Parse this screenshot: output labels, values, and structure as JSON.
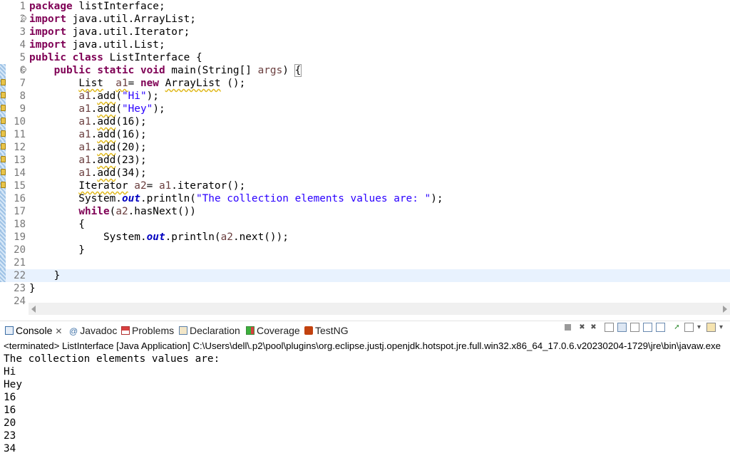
{
  "editor": {
    "lines": [
      {
        "n": "1",
        "html": "<span class='kw'>package</span> listInterface;"
      },
      {
        "n": "2",
        "html": "<span class='kw'>import</span> java.util.ArrayList;",
        "fold": "⊖"
      },
      {
        "n": "3",
        "html": "<span class='kw'>import</span> java.util.Iterator;"
      },
      {
        "n": "4",
        "html": "<span class='kw'>import</span> java.util.List;"
      },
      {
        "n": "5",
        "html": "<span class='kw'>public</span> <span class='kw'>class</span> ListInterface {"
      },
      {
        "n": "6",
        "html": "    <span class='kw'>public</span> <span class='kw'>static</span> <span class='kw'>void</span> main(String[] <span class='var'>args</span>) <span class='brace-box'>{</span>",
        "fold": "⊖",
        "mark": true
      },
      {
        "n": "7",
        "html": "        <span class='warnline'>List</span>  <span class='var warnline'>a1</span>= <span class='kw'>new</span> <span class='warnline'>ArrayList</span> ();",
        "mark": true,
        "warn": true
      },
      {
        "n": "8",
        "html": "        <span class='var'>a1</span>.<span class='warnline'>add</span>(<span class='str'>\"Hi\"</span>);",
        "mark": true,
        "warn": true
      },
      {
        "n": "9",
        "html": "        <span class='var'>a1</span>.<span class='warnline'>add</span>(<span class='str'>\"Hey\"</span>);",
        "mark": true,
        "warn": true
      },
      {
        "n": "10",
        "html": "        <span class='var'>a1</span>.<span class='warnline'>add</span>(16);",
        "mark": true,
        "warn": true
      },
      {
        "n": "11",
        "html": "        <span class='var'>a1</span>.<span class='warnline'>add</span>(16);",
        "mark": true,
        "warn": true
      },
      {
        "n": "12",
        "html": "        <span class='var'>a1</span>.<span class='warnline'>add</span>(20);",
        "mark": true,
        "warn": true
      },
      {
        "n": "13",
        "html": "        <span class='var'>a1</span>.<span class='warnline'>add</span>(23);",
        "mark": true,
        "warn": true
      },
      {
        "n": "14",
        "html": "        <span class='var'>a1</span>.<span class='warnline'>add</span>(34);",
        "mark": true,
        "warn": true
      },
      {
        "n": "15",
        "html": "        <span class='warnline'>Iterator</span> <span class='var'>a2</span>= <span class='var'>a1</span>.iterator();",
        "mark": true,
        "warn": true
      },
      {
        "n": "16",
        "html": "        System.<span class='static'>out</span>.println(<span class='str'>\"The collection elements values are: \"</span>);",
        "mark": true
      },
      {
        "n": "17",
        "html": "        <span class='kw'>while</span>(<span class='var'>a2</span>.hasNext())",
        "mark": true
      },
      {
        "n": "18",
        "html": "        {",
        "mark": true
      },
      {
        "n": "19",
        "html": "            System.<span class='static'>out</span>.println(<span class='var'>a2</span>.next());",
        "mark": true
      },
      {
        "n": "20",
        "html": "        }",
        "mark": true
      },
      {
        "n": "21",
        "html": "",
        "mark": true
      },
      {
        "n": "22",
        "html": "    }",
        "mark": true,
        "current": true
      },
      {
        "n": "23",
        "html": "}"
      },
      {
        "n": "24",
        "html": ""
      }
    ]
  },
  "console": {
    "tabs": [
      {
        "label": "Console",
        "icon": "console-icon",
        "active": true,
        "closable": true
      },
      {
        "label": "Javadoc",
        "icon": "javadoc-icon"
      },
      {
        "label": "Problems",
        "icon": "problems-icon"
      },
      {
        "label": "Declaration",
        "icon": "declaration-icon"
      },
      {
        "label": "Coverage",
        "icon": "coverage-icon"
      },
      {
        "label": "TestNG",
        "icon": "testng-icon"
      }
    ],
    "status": "<terminated> ListInterface [Java Application] C:\\Users\\dell\\.p2\\pool\\plugins\\org.eclipse.justj.openjdk.hotspot.jre.full.win32.x86_64_17.0.6.v20230204-1729\\jre\\bin\\javaw.exe",
    "output": [
      "The collection elements values are:",
      "Hi",
      "Hey",
      "16",
      "16",
      "20",
      "23",
      "34"
    ]
  }
}
